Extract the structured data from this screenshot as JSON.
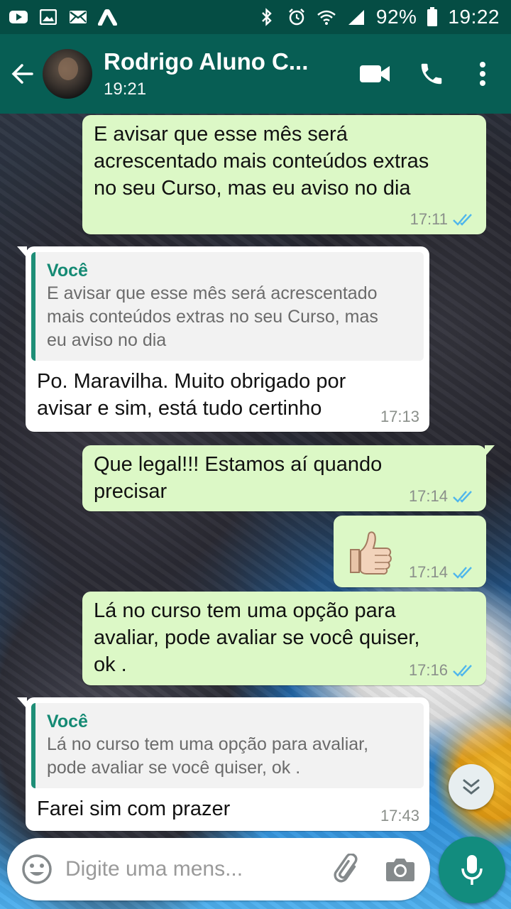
{
  "status_bar": {
    "battery": "92%",
    "time": "19:22",
    "left_icons": [
      "youtube-icon",
      "gallery-icon",
      "mail-icon",
      "adwords-icon"
    ],
    "right_icons": [
      "bluetooth-icon",
      "alarm-icon",
      "wifi-icon",
      "signal-icon",
      "battery-icon"
    ]
  },
  "header": {
    "contact_name": "Rodrigo Aluno C...",
    "last_seen": "19:21",
    "actions": [
      "video-call-icon",
      "voice-call-icon",
      "more-options-icon"
    ]
  },
  "messages": [
    {
      "direction": "out",
      "text": "E avisar que esse mês será\nacrescentado mais conteúdos extras\nno seu Curso, mas eu aviso no dia",
      "time": "17:11",
      "read": true
    },
    {
      "direction": "in",
      "quote_author": "Você",
      "quote_text": "E avisar que esse mês será acrescentado\nmais conteúdos extras no seu Curso, mas\neu aviso no dia",
      "text": "Po.  Maravilha. Muito obrigado por\navisar e sim, está tudo certinho",
      "time": "17:13"
    },
    {
      "direction": "out",
      "text": "Que legal!!! Estamos aí quando\nprecisar",
      "time": "17:14",
      "read": true
    },
    {
      "direction": "out",
      "sticker": "thumbs-up-emoji",
      "time": "17:14",
      "read": true
    },
    {
      "direction": "out",
      "text": "Lá no curso tem uma opção para\navaliar, pode avaliar se você quiser,\nok .",
      "time": "17:16",
      "read": true
    },
    {
      "direction": "in",
      "quote_author": "Você",
      "quote_text": "Lá no curso tem uma opção para avaliar,\npode avaliar se você quiser, ok .",
      "text": "Farei sim com prazer",
      "time": "17:43"
    }
  ],
  "composer": {
    "placeholder": "Digite uma mens...",
    "value": ""
  },
  "colors": {
    "status_bar": "#054d44",
    "header": "#075e54",
    "outgoing_bubble": "#dcf8c6",
    "incoming_bubble": "#ffffff",
    "read_ticks": "#4fb6ec",
    "quote_accent": "#1e8e77",
    "mic_button": "#128c7e"
  }
}
